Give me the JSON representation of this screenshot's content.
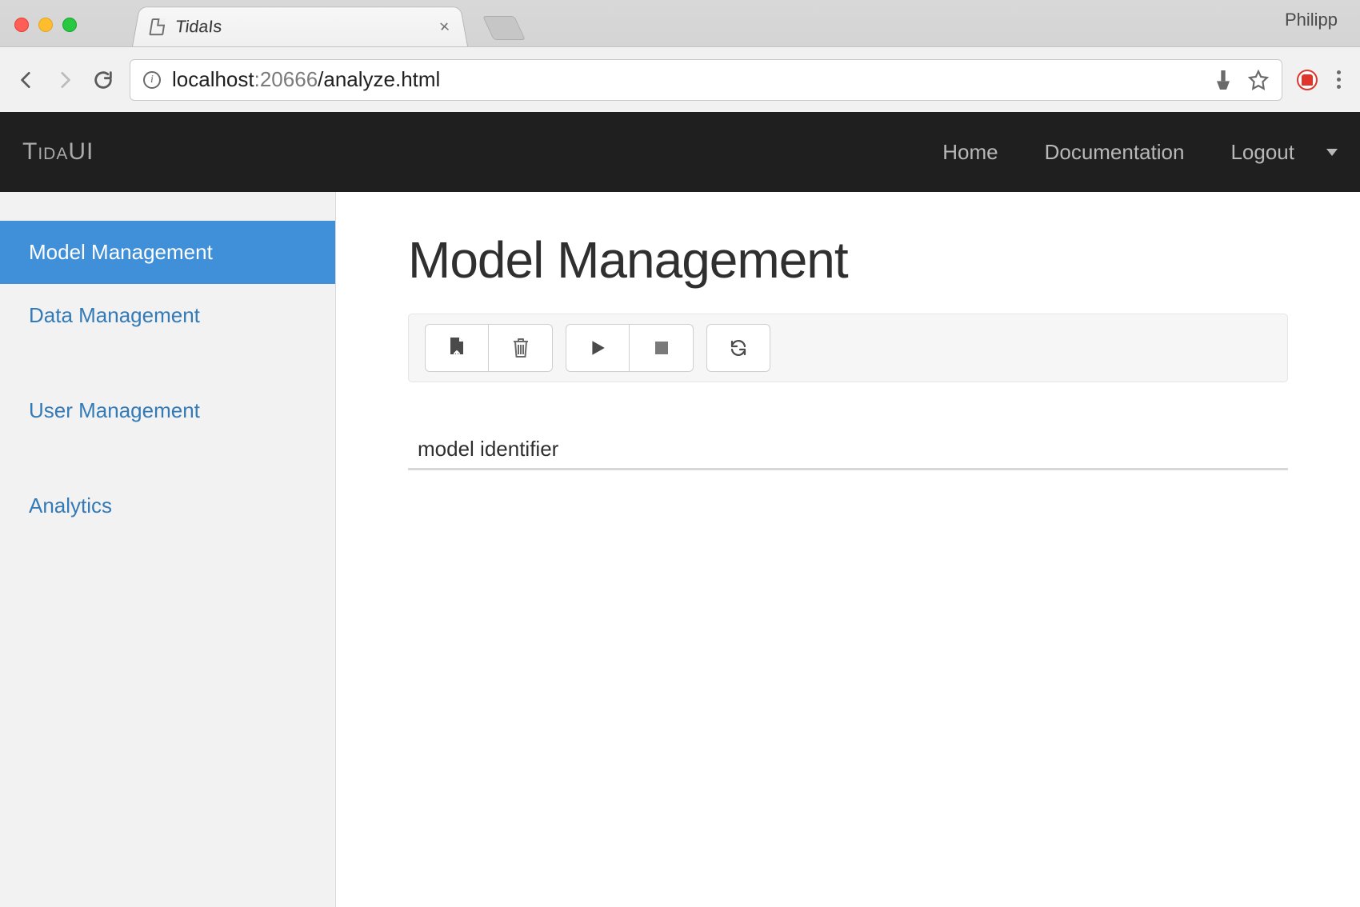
{
  "browser": {
    "os_user": "Philipp",
    "tab_title": "TidaIs",
    "url_host": "localhost",
    "url_port": ":20666",
    "url_path": "/analyze.html"
  },
  "navbar": {
    "brand": "TidaUI",
    "items": [
      "Home",
      "Documentation",
      "Logout"
    ]
  },
  "sidebar": {
    "items": [
      {
        "label": "Model Management",
        "active": true
      },
      {
        "label": "Data Management",
        "active": false
      },
      {
        "label": "User Management",
        "active": false
      },
      {
        "label": "Analytics",
        "active": false
      }
    ]
  },
  "page": {
    "title": "Model Management",
    "toolbar_icons": [
      "upload-file",
      "trash",
      "play",
      "stop",
      "refresh"
    ],
    "table_header": "model identifier"
  }
}
